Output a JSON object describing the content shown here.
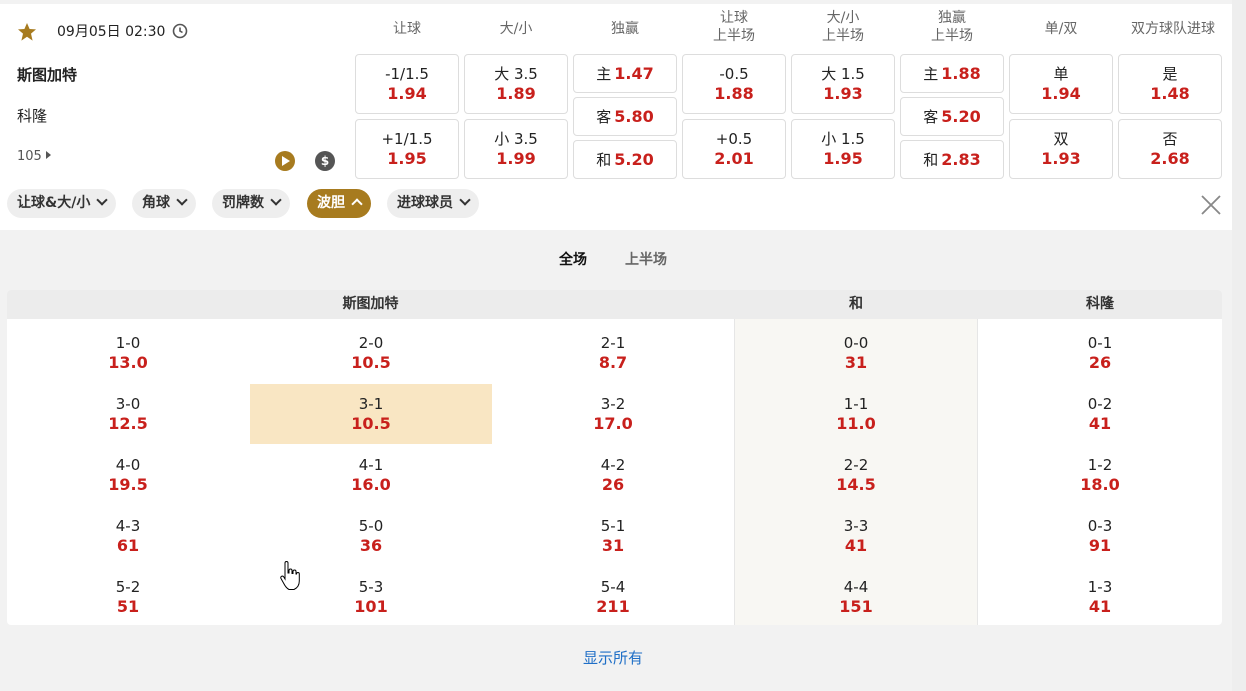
{
  "match": {
    "datetime": "09月05日 02:30",
    "home_team": "斯图加特",
    "away_team": "科隆",
    "more_markets_count": "105",
    "cash_icon_symbol": "$"
  },
  "columns": {
    "handicap": "让球",
    "over_under": "大/小",
    "moneyline": "独赢",
    "handicap_1h": [
      "让球",
      "上半场"
    ],
    "over_under_1h": [
      "大/小",
      "上半场"
    ],
    "moneyline_1h": [
      "独赢",
      "上半场"
    ],
    "odd_even": "单/双",
    "btts": "双方球队进球"
  },
  "odds": {
    "handicap": [
      {
        "label": "-1/1.5",
        "value": "1.94"
      },
      {
        "label": "+1/1.5",
        "value": "1.95"
      }
    ],
    "over_under": [
      {
        "label": "大 3.5",
        "value": "1.89"
      },
      {
        "label": "小 3.5",
        "value": "1.99"
      }
    ],
    "moneyline": [
      {
        "label": "主",
        "value": "1.47"
      },
      {
        "label": "客",
        "value": "5.80"
      },
      {
        "label": "和",
        "value": "5.20"
      }
    ],
    "handicap_1h": [
      {
        "label": "-0.5",
        "value": "1.88"
      },
      {
        "label": "+0.5",
        "value": "2.01"
      }
    ],
    "over_under_1h": [
      {
        "label": "大 1.5",
        "value": "1.93"
      },
      {
        "label": "小 1.5",
        "value": "1.95"
      }
    ],
    "moneyline_1h": [
      {
        "label": "主",
        "value": "1.88"
      },
      {
        "label": "客",
        "value": "5.20"
      },
      {
        "label": "和",
        "value": "2.83"
      }
    ],
    "odd_even": [
      {
        "label": "单",
        "value": "1.94"
      },
      {
        "label": "双",
        "value": "1.93"
      }
    ],
    "btts": [
      {
        "label": "是",
        "value": "1.48"
      },
      {
        "label": "否",
        "value": "2.68"
      }
    ]
  },
  "chips": [
    {
      "label": "让球&大/小",
      "active": false
    },
    {
      "label": "角球",
      "active": false
    },
    {
      "label": "罚牌数",
      "active": false
    },
    {
      "label": "波胆",
      "active": true
    },
    {
      "label": "进球球员",
      "active": false
    }
  ],
  "tabs": [
    {
      "label": "全场",
      "active": true
    },
    {
      "label": "上半场",
      "active": false
    }
  ],
  "correct_score": {
    "headers": {
      "home": "斯图加特",
      "draw": "和",
      "away": "科隆"
    },
    "home_col1": [
      {
        "score": "1-0",
        "odds": "13.0"
      },
      {
        "score": "3-0",
        "odds": "12.5"
      },
      {
        "score": "4-0",
        "odds": "19.5"
      },
      {
        "score": "4-3",
        "odds": "61"
      },
      {
        "score": "5-2",
        "odds": "51"
      }
    ],
    "home_col2": [
      {
        "score": "2-0",
        "odds": "10.5"
      },
      {
        "score": "3-1",
        "odds": "10.5",
        "selected": true
      },
      {
        "score": "4-1",
        "odds": "16.0"
      },
      {
        "score": "5-0",
        "odds": "36"
      },
      {
        "score": "5-3",
        "odds": "101"
      }
    ],
    "home_col3": [
      {
        "score": "2-1",
        "odds": "8.7"
      },
      {
        "score": "3-2",
        "odds": "17.0"
      },
      {
        "score": "4-2",
        "odds": "26"
      },
      {
        "score": "5-1",
        "odds": "31"
      },
      {
        "score": "5-4",
        "odds": "211"
      }
    ],
    "draw_col": [
      {
        "score": "0-0",
        "odds": "31"
      },
      {
        "score": "1-1",
        "odds": "11.0"
      },
      {
        "score": "2-2",
        "odds": "14.5"
      },
      {
        "score": "3-3",
        "odds": "41"
      },
      {
        "score": "4-4",
        "odds": "151"
      }
    ],
    "away_col": [
      {
        "score": "0-1",
        "odds": "26"
      },
      {
        "score": "0-2",
        "odds": "41"
      },
      {
        "score": "1-2",
        "odds": "18.0"
      },
      {
        "score": "0-3",
        "odds": "91"
      },
      {
        "score": "1-3",
        "odds": "41"
      }
    ]
  },
  "show_all_label": "显示所有",
  "colors": {
    "odds_red": "#c8201c",
    "accent_gold": "#a77b1f",
    "selected_cell": "#f9e6c3",
    "link_blue": "#1f6fc7"
  }
}
